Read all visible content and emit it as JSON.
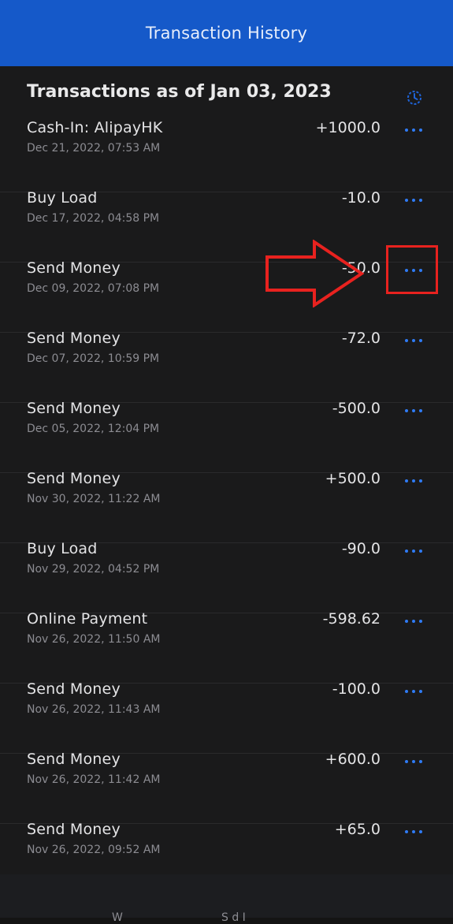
{
  "header": {
    "title": "Transaction History"
  },
  "section": {
    "title": "Transactions as of Jan 03, 2023",
    "history_icon": "history-clock-icon"
  },
  "transactions": [
    {
      "title": "Cash-In: AlipayHK",
      "date": "Dec 21, 2022, 07:53 AM",
      "amount": "+1000.0"
    },
    {
      "title": "Buy Load",
      "date": "Dec 17, 2022, 04:58 PM",
      "amount": "-10.0"
    },
    {
      "title": "Send Money",
      "date": "Dec 09, 2022, 07:08 PM",
      "amount": "-50.0"
    },
    {
      "title": "Send Money",
      "date": "Dec 07, 2022, 10:59 PM",
      "amount": "-72.0"
    },
    {
      "title": "Send Money",
      "date": "Dec 05, 2022, 12:04 PM",
      "amount": "-500.0"
    },
    {
      "title": "Send Money",
      "date": "Nov 30, 2022, 11:22 AM",
      "amount": "+500.0"
    },
    {
      "title": "Buy Load",
      "date": "Nov 29, 2022, 04:52 PM",
      "amount": "-90.0"
    },
    {
      "title": "Online Payment",
      "date": "Nov 26, 2022, 11:50 AM",
      "amount": "-598.62"
    },
    {
      "title": "Send Money",
      "date": "Nov 26, 2022, 11:43 AM",
      "amount": "-100.0"
    },
    {
      "title": "Send Money",
      "date": "Nov 26, 2022, 11:42 AM",
      "amount": "+600.0"
    },
    {
      "title": "Send Money",
      "date": "Nov 26, 2022, 09:52 AM",
      "amount": "+65.0"
    }
  ],
  "more_icon": "more-horizontal-icon",
  "colors": {
    "header_bg": "#1559C9",
    "accent": "#2F7BF5",
    "annotation": "#E8221F",
    "background": "#1A1A1B"
  },
  "bottom_nav": {
    "partial_labels": [
      "W",
      "S d I"
    ]
  }
}
